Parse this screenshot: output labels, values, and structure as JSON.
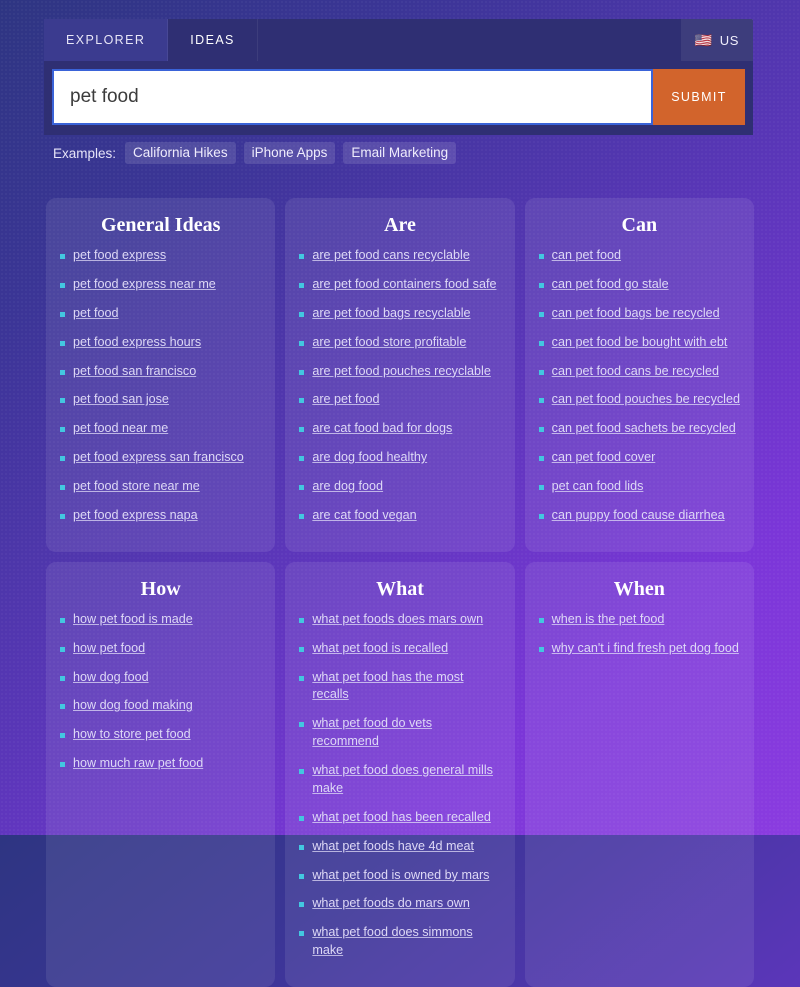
{
  "header": {
    "tabs": [
      {
        "label": "EXPLORER",
        "active": false
      },
      {
        "label": "IDEAS",
        "active": true
      }
    ],
    "locale": {
      "flag": "🇺🇸",
      "label": "US"
    }
  },
  "search": {
    "value": "pet food",
    "placeholder": "Enter a keyword",
    "submit_label": "SUBMIT"
  },
  "examples": {
    "label": "Examples:",
    "chips": [
      "California Hikes",
      "iPhone Apps",
      "Email Marketing"
    ]
  },
  "colors": {
    "accent_orange": "#d2642c",
    "bullet_cyan": "#43c7e0",
    "panel_navy": "#2f2f73",
    "tab_inactive": "#3b3b8f",
    "link_text": "#ded9f6"
  },
  "cards": [
    {
      "title": "General Ideas",
      "items": [
        "pet food express",
        "pet food express near me",
        "pet food",
        "pet food express hours",
        "pet food san francisco",
        "pet food san jose",
        "pet food near me",
        "pet food express san francisco",
        "pet food store near me",
        "pet food express napa"
      ]
    },
    {
      "title": "Are",
      "items": [
        "are pet food cans recyclable",
        "are pet food containers food safe",
        "are pet food bags recyclable",
        "are pet food store profitable",
        "are pet food pouches recyclable",
        "are pet food",
        "are cat food bad for dogs",
        "are dog food healthy",
        "are dog food",
        "are cat food vegan"
      ]
    },
    {
      "title": "Can",
      "items": [
        "can pet food",
        "can pet food go stale",
        "can pet food bags be recycled",
        "can pet food be bought with ebt",
        "can pet food cans be recycled",
        "can pet food pouches be recycled",
        "can pet food sachets be recycled",
        "can pet food cover",
        "pet can food lids",
        "can puppy food cause diarrhea"
      ]
    },
    {
      "title": "How",
      "items": [
        "how pet food is made",
        "how pet food",
        "how dog food",
        "how dog food making",
        "how to store pet food",
        "how much raw pet food"
      ]
    },
    {
      "title": "What",
      "items": [
        "what pet foods does mars own",
        "what pet food is recalled",
        "what pet food has the most recalls",
        "what pet food do vets recommend",
        "what pet food does general mills make",
        "what pet food has been recalled",
        "what pet foods have 4d meat",
        "what pet food is owned by mars",
        "what pet foods do mars own",
        "what pet food does simmons make"
      ]
    },
    {
      "title": "When",
      "items": [
        "when is the pet food",
        "why can't i find fresh pet dog food"
      ]
    }
  ]
}
